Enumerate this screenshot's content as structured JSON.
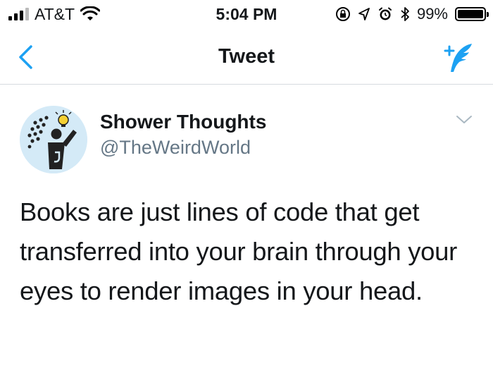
{
  "status_bar": {
    "carrier": "AT&T",
    "time": "5:04 PM",
    "battery_percent": "99%",
    "battery_level": 0.99,
    "icons": [
      "signal-icon",
      "wifi-icon",
      "screen-lock-icon",
      "location-icon",
      "alarm-icon",
      "bluetooth-icon",
      "battery-icon"
    ]
  },
  "nav": {
    "back_icon": "chevron-left-icon",
    "title": "Tweet",
    "compose_icon": "compose-tweet-icon",
    "accent_color": "#1da1f2"
  },
  "tweet": {
    "author_name": "Shower Thoughts",
    "author_handle": "@TheWeirdWorld",
    "text": "Books are just lines of code that get transferred into your brain through your eyes to render images in your head.",
    "more_icon": "chevron-down-icon"
  }
}
